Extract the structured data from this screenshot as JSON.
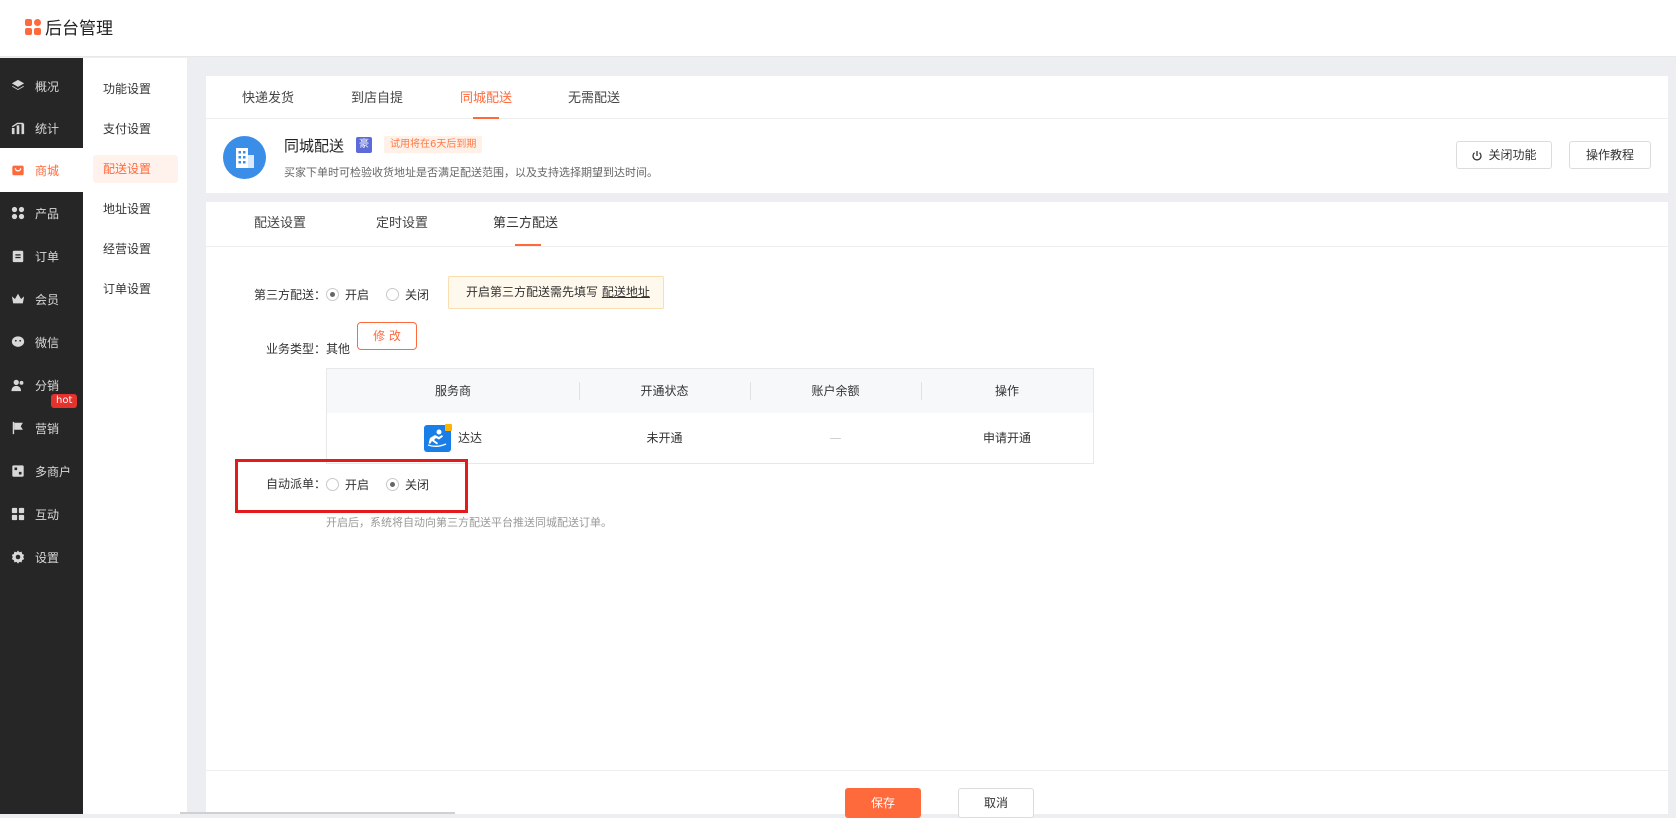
{
  "app": {
    "title": "后台管理",
    "accent": "#ff6a3d"
  },
  "sidebar": {
    "items": [
      {
        "label": "概况",
        "icon": "layers-icon"
      },
      {
        "label": "统计",
        "icon": "chart-icon"
      },
      {
        "label": "商城",
        "icon": "store-icon",
        "active": true
      },
      {
        "label": "产品",
        "icon": "apps-icon"
      },
      {
        "label": "订单",
        "icon": "clipboard-icon"
      },
      {
        "label": "会员",
        "icon": "crown-icon"
      },
      {
        "label": "微信",
        "icon": "wechat-icon"
      },
      {
        "label": "分销",
        "icon": "users-icon"
      },
      {
        "label": "营销",
        "icon": "flag-icon",
        "badge": "hot"
      },
      {
        "label": "多商户",
        "icon": "shop-icon"
      },
      {
        "label": "互动",
        "icon": "grid-icon"
      },
      {
        "label": "设置",
        "icon": "gear-icon"
      }
    ]
  },
  "subnav": {
    "items": [
      "功能设置",
      "支付设置",
      "配送设置",
      "地址设置",
      "经营设置",
      "订单设置"
    ],
    "active": "配送设置"
  },
  "top_tabs": {
    "items": [
      "快递发货",
      "到店自提",
      "同城配送",
      "无需配送"
    ],
    "active": "同城配送"
  },
  "feature": {
    "title": "同城配送",
    "vip_badge": "豪",
    "trial": "试用将在6天后到期",
    "desc": "买家下单时可检验收货地址是否满足配送范围，以及支持选择期望到达时间。",
    "close_button": "关闭功能",
    "tutorial_button": "操作教程"
  },
  "sub_tabs": {
    "items": [
      "配送设置",
      "定时设置",
      "第三方配送"
    ],
    "active": "第三方配送"
  },
  "form": {
    "third_party": {
      "label": "第三方配送：",
      "options": [
        "开启",
        "关闭"
      ],
      "selected": "开启",
      "notice_text": "开启第三方配送需先填写",
      "notice_link": "配送地址"
    },
    "business_type": {
      "label": "业务类型：",
      "value": "其他",
      "modify_button": "修 改"
    },
    "table": {
      "headers": [
        "服务商",
        "开通状态",
        "账户余额",
        "操作"
      ],
      "rows": [
        {
          "provider": "达达",
          "status": "未开通",
          "balance": "—",
          "action": "申请开通"
        }
      ]
    },
    "auto_dispatch": {
      "label": "自动派单：",
      "options": [
        "开启",
        "关闭"
      ],
      "selected": "关闭",
      "hint": "开启后，系统将自动向第三方配送平台推送同城配送订单。"
    }
  },
  "footer": {
    "save": "保存",
    "cancel": "取消"
  }
}
